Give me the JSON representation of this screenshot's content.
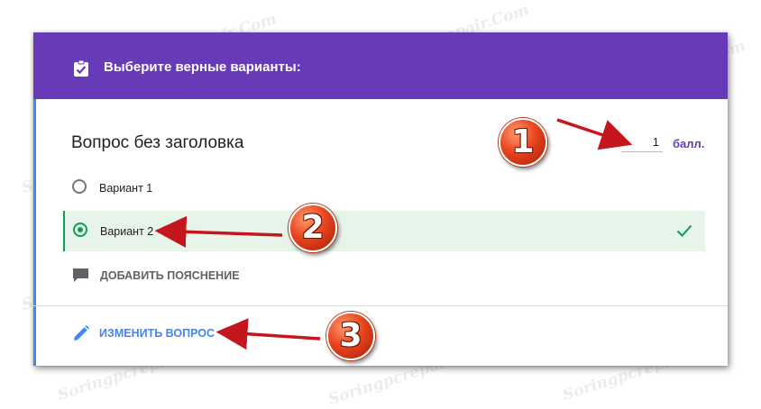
{
  "header": {
    "icon": "checklist-icon",
    "title": "Выберите верные варианты:"
  },
  "question": {
    "title": "Вопрос без заголовка",
    "points_value": "1",
    "points_unit": "балл."
  },
  "options": [
    {
      "label": "Вариант 1",
      "selected": false,
      "correct": false
    },
    {
      "label": "Вариант 2",
      "selected": true,
      "correct": true
    }
  ],
  "actions": {
    "add_explanation": "ДОБАВИТЬ ПОЯСНЕНИЕ",
    "edit_question": "ИЗМЕНИТЬ ВОПРОС"
  },
  "annotations": {
    "badge_1": "1",
    "badge_2": "2",
    "badge_3": "3"
  },
  "watermark": "Soringpcrepair.Com",
  "colors": {
    "header_bg": "#673ab7",
    "accent_blue": "#4285f4",
    "correct_green": "#0f9d58",
    "correct_bg": "#e6f4ea",
    "badge_red": "#e8441f",
    "arrow_red": "#c4161c"
  }
}
